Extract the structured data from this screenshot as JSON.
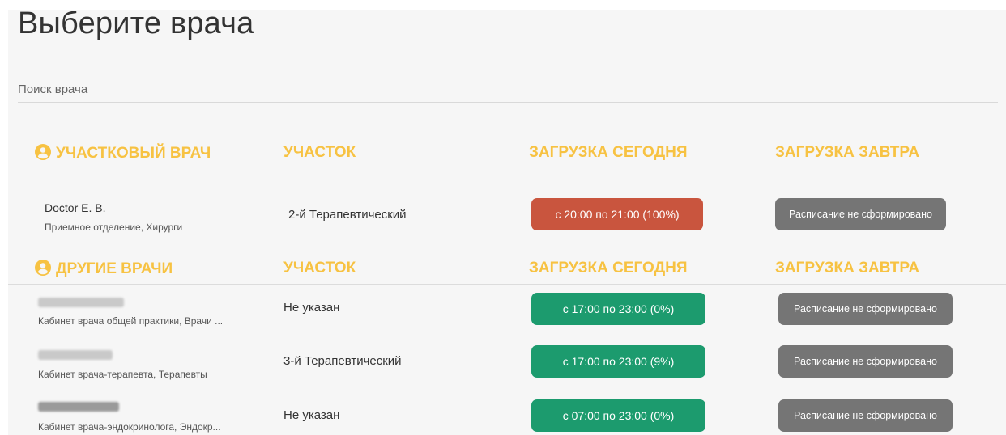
{
  "page": {
    "title": "Выберите врача"
  },
  "search": {
    "placeholder": "Поиск врача"
  },
  "local_section": {
    "headers": {
      "doctor": "УЧАСТКОВЫЙ ВРАЧ",
      "district": "УЧАСТОК",
      "load_today": "ЗАГРУЗКА СЕГОДНЯ",
      "load_tomorrow": "ЗАГРУЗКА ЗАВТРА"
    },
    "doctor": {
      "name": "Doctor E. B.",
      "department": "Приемное отделение, Хирурги",
      "district": "2-й Терапевтический",
      "today": "с 20:00 по 21:00 (100%)",
      "tomorrow": "Расписание не сформировано"
    }
  },
  "other_section": {
    "headers": {
      "doctor": "ДРУГИЕ ВРАЧИ",
      "district": "УЧАСТОК",
      "load_today": "ЗАГРУЗКА СЕГОДНЯ",
      "load_tomorrow": "ЗАГРУЗКА ЗАВТРА"
    },
    "doctors": [
      {
        "department": "Кабинет врача общей практики, Врачи ...",
        "district": "Не указан",
        "today": "с 17:00 по 23:00 (0%)",
        "tomorrow": "Расписание не сформировано"
      },
      {
        "department": "Кабинет врача-терапевта, Терапевты",
        "district": "3-й Терапевтический",
        "today": "с 17:00 по 23:00 (9%)",
        "tomorrow": "Расписание не сформировано"
      },
      {
        "department": "Кабинет врача-эндокринолога, Эндокр...",
        "district": "Не указан",
        "today": "с 07:00 по 23:00 (0%)",
        "tomorrow": "Расписание не сформировано"
      }
    ]
  },
  "colors": {
    "accent": "#f7c242",
    "busy": "#c9553e",
    "free": "#1c9b6e",
    "not_formed": "#757575"
  },
  "icons": {
    "section_icon": "user-circle-icon"
  }
}
